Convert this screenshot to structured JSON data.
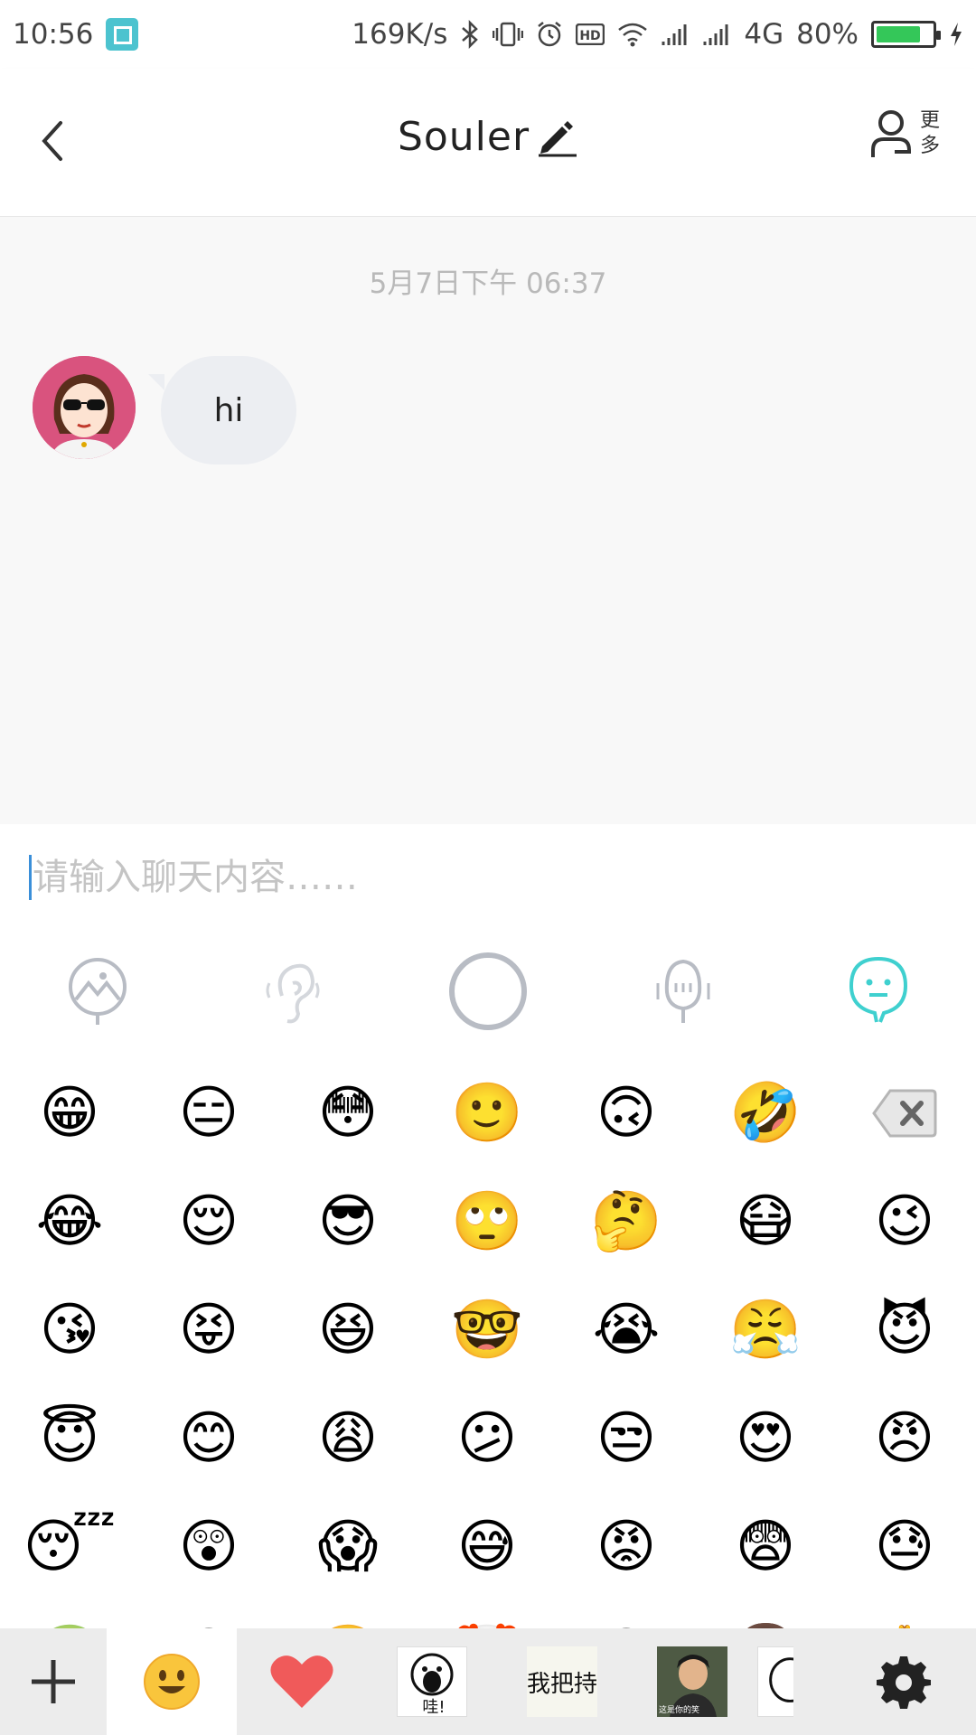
{
  "status_bar": {
    "time": "10:56",
    "network_speed": "169K/s",
    "network_type": "4G",
    "battery": "80%",
    "battery_level": 0.8,
    "icons": [
      "screenshot-icon",
      "bluetooth-icon",
      "vibrate-icon",
      "alarm-icon",
      "hd-icon",
      "wifi-icon",
      "signal-icon",
      "signal-icon",
      "charging-icon"
    ]
  },
  "header": {
    "title": "Souler",
    "more_label": "更多",
    "icons": [
      "back-icon",
      "edit-icon",
      "person-icon"
    ]
  },
  "chat": {
    "timestamp": "5月7日下午 06:37",
    "messages": [
      {
        "sender": "other",
        "text": "hi"
      }
    ]
  },
  "input": {
    "placeholder": "请输入聊天内容……",
    "value": ""
  },
  "modes": [
    {
      "name": "photo-mode",
      "active": false
    },
    {
      "name": "voice-mode",
      "active": false
    },
    {
      "name": "record-mode",
      "active": false
    },
    {
      "name": "mic-mode",
      "active": false
    },
    {
      "name": "emoji-mode",
      "active": true
    }
  ],
  "emoji_rows": [
    [
      "😁",
      "😑",
      "😳",
      "🙂",
      "🙃",
      "🤣",
      "⌫"
    ],
    [
      "😂",
      "😌",
      "😎",
      "🙄",
      "🤔",
      "😷",
      "😉"
    ],
    [
      "😘",
      "😝",
      "😆",
      "🤓",
      "😭",
      "😤",
      "😈"
    ],
    [
      "😇",
      "😊",
      "😩",
      "😕",
      "😒",
      "😍",
      "😠"
    ],
    [
      "😴",
      "😲",
      "😱",
      "😅",
      "😡",
      "😨",
      "😓"
    ],
    [
      "🤢",
      "😀",
      "😬",
      "🤡",
      "😏",
      "👩",
      "🙏"
    ]
  ],
  "tabs": {
    "sticker_text": "我把持",
    "sticker_caption": "这是你的笑"
  },
  "colors": {
    "accent": "#4cc3cf",
    "heart": "#f05a5a",
    "bubble": "#eceef2"
  }
}
